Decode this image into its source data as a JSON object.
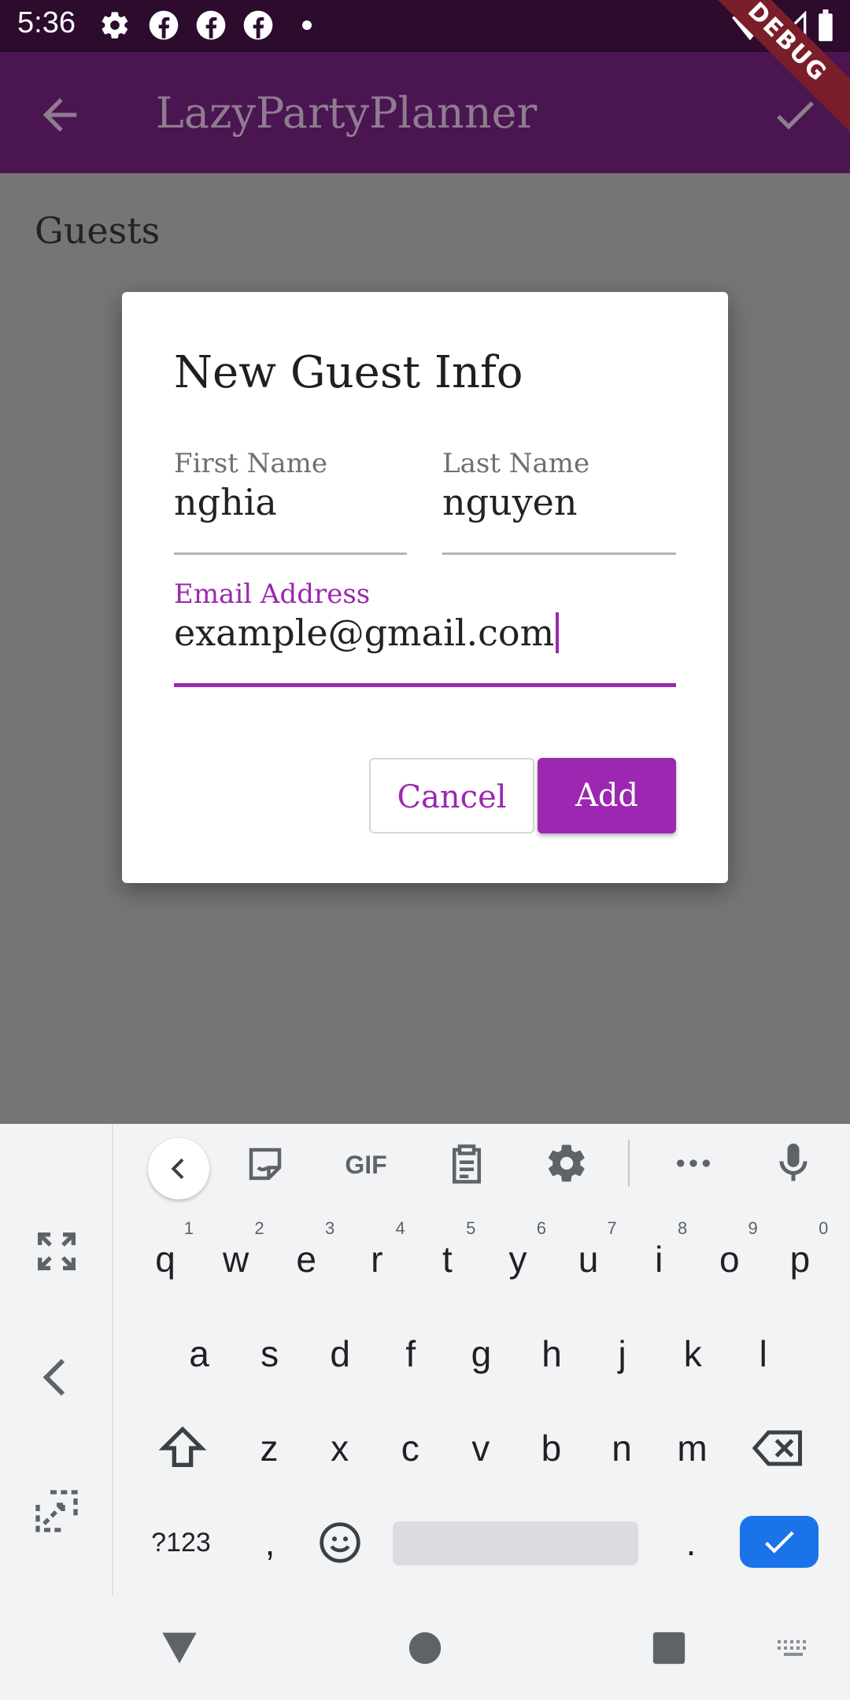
{
  "status_bar": {
    "time": "5:36"
  },
  "app_bar": {
    "title": "LazyPartyPlanner",
    "debug_label": "DEBUG"
  },
  "content": {
    "section_title": "Guests"
  },
  "dialog": {
    "title": "New Guest Info",
    "first_name": {
      "label": "First Name",
      "value": "nghia"
    },
    "last_name": {
      "label": "Last Name",
      "value": "nguyen"
    },
    "email": {
      "label": "Email Address",
      "value": "example@gmail.com"
    },
    "cancel_label": "Cancel",
    "add_label": "Add"
  },
  "colors": {
    "accent": "#9c27b0",
    "app_bar": "#4a1550",
    "fab": "#7a5b06",
    "enter_key": "#1a73e8"
  },
  "keyboard": {
    "row1": [
      {
        "k": "q",
        "h": "1"
      },
      {
        "k": "w",
        "h": "2"
      },
      {
        "k": "e",
        "h": "3"
      },
      {
        "k": "r",
        "h": "4"
      },
      {
        "k": "t",
        "h": "5"
      },
      {
        "k": "y",
        "h": "6"
      },
      {
        "k": "u",
        "h": "7"
      },
      {
        "k": "i",
        "h": "8"
      },
      {
        "k": "o",
        "h": "9"
      },
      {
        "k": "p",
        "h": "0"
      }
    ],
    "row2": [
      "a",
      "s",
      "d",
      "f",
      "g",
      "h",
      "j",
      "k",
      "l"
    ],
    "row3": [
      "z",
      "x",
      "c",
      "v",
      "b",
      "n",
      "m"
    ],
    "symbols_label": "?123",
    "comma": ",",
    "period": ".",
    "gif_label": "GIF"
  }
}
